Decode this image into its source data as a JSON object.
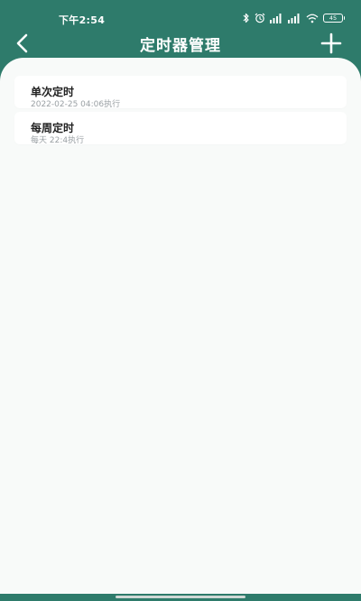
{
  "status_bar": {
    "time": "下午2:54",
    "battery": "45",
    "icons": [
      "bluetooth-icon",
      "alarm-icon",
      "signal-icon",
      "signal-icon",
      "wifi-icon",
      "battery-icon"
    ]
  },
  "header": {
    "title": "定时器管理",
    "back_icon": "chevron-left-icon",
    "add_icon": "plus-icon"
  },
  "timers": [
    {
      "name": "单次定时",
      "desc": "2022-02-25 04:06执行"
    },
    {
      "name": "每周定时",
      "desc": "每天 22:4执行"
    }
  ],
  "colors": {
    "primary": "#2e7b6b",
    "content_bg": "#f8faf9",
    "card_bg": "#ffffff",
    "title_text": "#222222",
    "sub_text": "#9aa0a4"
  }
}
